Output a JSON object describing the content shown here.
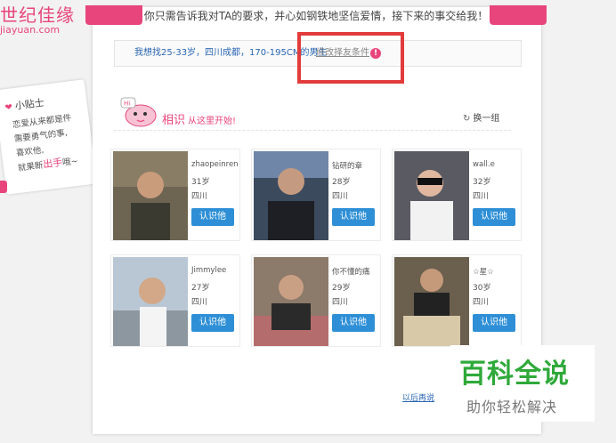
{
  "logo": {
    "cn": "世纪佳缘",
    "en": "jiayuan.com"
  },
  "tip": {
    "title": "小贴士",
    "line1": "恋爱从来都是件",
    "line2": "需要勇气的事,",
    "line3": "喜欢他,",
    "line4_prefix": "就果断",
    "line4_em": "出手",
    "line4_suffix": "哦~"
  },
  "headline": "你只需告诉我对TA的要求，并心如钢铁地坚信爱情，接下来的事交给我！",
  "condition": {
    "text": "我想找25-33岁，四川成都，170-195CM的男生",
    "modify_link": "修改择友条件",
    "warn_glyph": "!"
  },
  "section": {
    "title": "相识",
    "subtitle": "从这里开始!",
    "refresh": "换一组",
    "refresh_icon": "refresh-icon",
    "mascot_text": "Hi"
  },
  "cards": [
    {
      "name": "zhaopeinren",
      "age": "31岁",
      "region": "四川",
      "button": "认识他"
    },
    {
      "name": "钻研的章",
      "age": "28岁",
      "region": "四川",
      "button": "认识他"
    },
    {
      "name": "wall.e",
      "age": "32岁",
      "region": "四川",
      "button": "认识他"
    },
    {
      "name": "Jimmylee",
      "age": "27岁",
      "region": "四川",
      "button": "认识他"
    },
    {
      "name": "你不懂的痛",
      "age": "29岁",
      "region": "四川",
      "button": "认识他"
    },
    {
      "name": "☆星☆",
      "age": "30岁",
      "region": "四川",
      "button": "认识他"
    }
  ],
  "later_link": "以后再说",
  "watermark": {
    "title": "百科全说",
    "subtitle": "助你轻松解决"
  },
  "colors": {
    "brand_pink": "#e8457c",
    "button_blue": "#2e8fd6",
    "highlight_red": "#e23b3b",
    "watermark_green": "#2fa93a"
  }
}
